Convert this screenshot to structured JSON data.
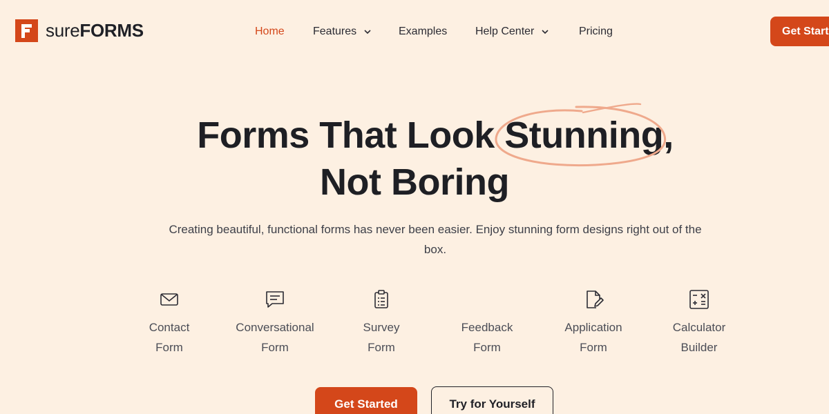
{
  "brand": {
    "name_light": "sure",
    "name_bold": "FORMS",
    "accent": "#d4471a",
    "background": "#fdf0e2"
  },
  "nav": {
    "items": [
      {
        "label": "Home",
        "active": true,
        "dropdown": false
      },
      {
        "label": "Features",
        "active": false,
        "dropdown": true
      },
      {
        "label": "Examples",
        "active": false,
        "dropdown": false
      },
      {
        "label": "Help Center",
        "active": false,
        "dropdown": true
      },
      {
        "label": "Pricing",
        "active": false,
        "dropdown": false
      }
    ],
    "cta_label": "Get Start"
  },
  "hero": {
    "title_line1": "Forms That Look Stunning,",
    "title_line2": "Not Boring",
    "highlight_word": "Stunning",
    "subtitle": "Creating beautiful, functional forms has never been easier. Enjoy stunning form designs right out of the box."
  },
  "form_types": [
    {
      "icon": "envelope-icon",
      "label": "Contact\nForm"
    },
    {
      "icon": "chat-bubble-icon",
      "label": "Conversational\nForm"
    },
    {
      "icon": "clipboard-icon",
      "label": "Survey\nForm"
    },
    {
      "icon": "none",
      "label": "Feedback\nForm"
    },
    {
      "icon": "document-edit-icon",
      "label": "Application\nForm"
    },
    {
      "icon": "calculator-icon",
      "label": "Calculator\nBuilder"
    }
  ],
  "buttons": {
    "primary": "Get Started",
    "secondary": "Try for Yourself"
  }
}
